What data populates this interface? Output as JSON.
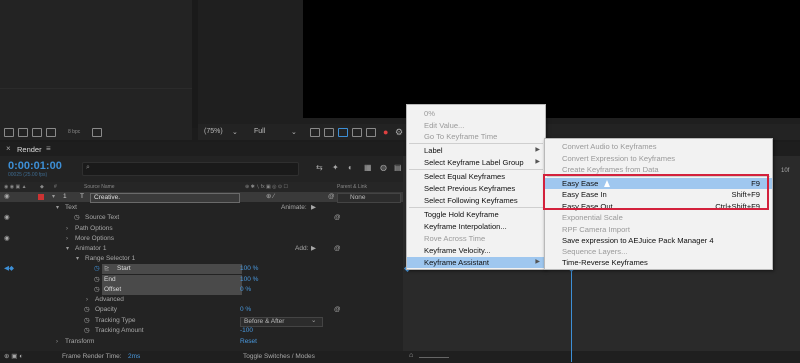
{
  "app": {
    "project_toolbar": {
      "bpc": "8 bpc"
    },
    "comp_toolbar": {
      "zoom": "(75%)",
      "resolution": "Full"
    },
    "timeline": {
      "tab_label": "Render",
      "time": "0:00:01:00",
      "time_sub": "00025 (25.00 fps)",
      "columns": {
        "source_name": "Source Name",
        "parent_link": "Parent & Link"
      },
      "layer": {
        "number": "1",
        "name": "Creative.",
        "parent": "None"
      },
      "rows": {
        "text": "Text",
        "animate_label": "Animate:",
        "source_text": "Source Text",
        "path_options": "Path Options",
        "more_options": "More Options",
        "animator": "Animator 1",
        "add_label": "Add:",
        "range_selector": "Range Selector 1",
        "start": "Start",
        "start_value": "100 %",
        "end": "End",
        "end_value": "100 %",
        "offset": "Offset",
        "offset_value": "0 %",
        "advanced": "Advanced",
        "opacity": "Opacity",
        "opacity_value": "0 %",
        "tracking_type": "Tracking Type",
        "tracking_type_value": "Before & After",
        "tracking_amount": "Tracking Amount",
        "tracking_amount_value": "-100",
        "transform": "Transform",
        "transform_value": "Reset"
      },
      "footer": {
        "render_time_label": "Frame Render Time:",
        "render_time_value": "2ms",
        "toggle": "Toggle Switches / Modes"
      },
      "ruler_end": "10f"
    }
  },
  "context_menu": {
    "items": [
      {
        "label": "0%",
        "disabled": true
      },
      {
        "label": "Edit Value...",
        "disabled": true
      },
      {
        "label": "Go To Keyframe Time",
        "disabled": true
      },
      {
        "label": "Label",
        "submenu": true
      },
      {
        "label": "Select Keyframe Label Group",
        "submenu": true
      },
      {
        "label": "Select Equal Keyframes"
      },
      {
        "label": "Select Previous Keyframes"
      },
      {
        "label": "Select Following Keyframes"
      },
      {
        "label": "Toggle Hold Keyframe"
      },
      {
        "label": "Keyframe Interpolation..."
      },
      {
        "label": "Rove Across Time",
        "disabled": true
      },
      {
        "label": "Keyframe Velocity..."
      },
      {
        "label": "Keyframe Assistant",
        "submenu": true,
        "selected": true
      }
    ]
  },
  "submenu": {
    "items": [
      {
        "label": "Convert Audio to Keyframes",
        "disabled": true
      },
      {
        "label": "Convert Expression to Keyframes",
        "disabled": true
      },
      {
        "label": "Create Keyframes from Data",
        "disabled": true
      },
      {
        "label": "Easy Ease",
        "shortcut": "F9",
        "selected": true
      },
      {
        "label": "Easy Ease In",
        "shortcut": "Shift+F9"
      },
      {
        "label": "Easy Ease Out",
        "shortcut": "Ctrl+Shift+F9"
      },
      {
        "label": "Exponential Scale",
        "disabled": true
      },
      {
        "label": "RPF Camera Import",
        "disabled": true
      },
      {
        "label": "Save expression to AEJuice Pack Manager 4"
      },
      {
        "label": "Sequence Layers...",
        "disabled": true
      },
      {
        "label": "Time-Reverse Keyframes"
      }
    ]
  },
  "colors": {
    "accent_blue": "#3d8fd6",
    "menu_highlight": "#9fc7ef",
    "callout_red": "#d3213c"
  }
}
